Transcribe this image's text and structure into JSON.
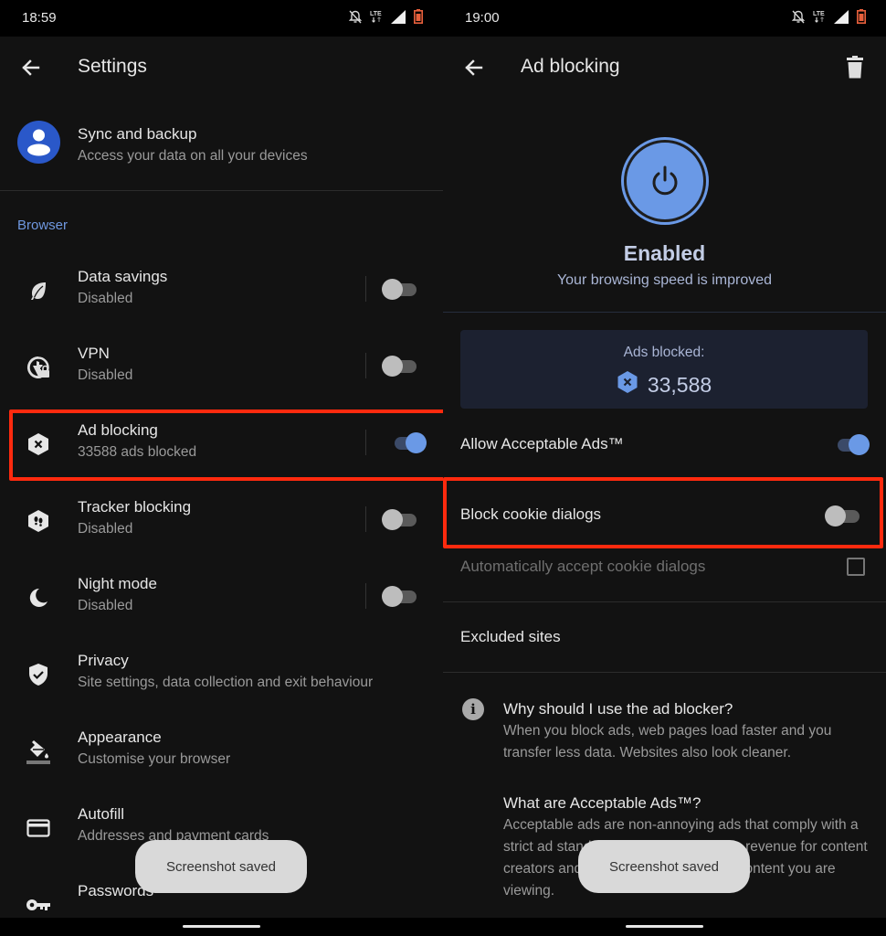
{
  "left": {
    "status": {
      "time": "18:59",
      "network": "LTE"
    },
    "appbar": {
      "title": "Settings"
    },
    "sync": {
      "title": "Sync and backup",
      "subtitle": "Access your data on all your devices"
    },
    "section_label": "Browser",
    "items": [
      {
        "id": "data-savings",
        "icon": "leaf-icon",
        "title": "Data savings",
        "subtitle": "Disabled",
        "toggle": false
      },
      {
        "id": "vpn",
        "icon": "globe-lock-icon",
        "title": "VPN",
        "subtitle": "Disabled",
        "toggle": false
      },
      {
        "id": "ad-blocking",
        "icon": "ad-block-hexagon-icon",
        "title": "Ad blocking",
        "subtitle": "33588 ads blocked",
        "toggle": true,
        "highlighted": true
      },
      {
        "id": "tracker-blocking",
        "icon": "footprints-hexagon-icon",
        "title": "Tracker blocking",
        "subtitle": "Disabled",
        "toggle": false
      },
      {
        "id": "night-mode",
        "icon": "moon-icon",
        "title": "Night mode",
        "subtitle": "Disabled",
        "toggle": false
      },
      {
        "id": "privacy",
        "icon": "shield-check-icon",
        "title": "Privacy",
        "subtitle": "Site settings, data collection and exit behaviour"
      },
      {
        "id": "appearance",
        "icon": "paint-bucket-icon",
        "title": "Appearance",
        "subtitle": "Customise your browser"
      },
      {
        "id": "autofill",
        "icon": "credit-card-icon",
        "title": "Autofill",
        "subtitle": "Addresses and payment cards"
      },
      {
        "id": "passwords",
        "icon": "key-icon",
        "title": "Passwords",
        "subtitle": ""
      }
    ],
    "toast": "Screenshot saved"
  },
  "right": {
    "status": {
      "time": "19:00",
      "network": "LTE"
    },
    "appbar": {
      "title": "Ad blocking"
    },
    "state": {
      "title": "Enabled",
      "subtitle": "Your browsing speed is improved"
    },
    "stats": {
      "label": "Ads blocked:",
      "value": "33,588"
    },
    "options": [
      {
        "id": "allow-acceptable-ads",
        "label": "Allow Acceptable Ads™",
        "toggle": true
      },
      {
        "id": "block-cookie-dialogs",
        "label": "Block cookie dialogs",
        "toggle": false,
        "highlighted": true
      },
      {
        "id": "auto-accept-cookie-dialogs",
        "label": "Automatically accept cookie dialogs",
        "checkbox": false,
        "disabled": true
      }
    ],
    "excluded_sites": "Excluded sites",
    "faq": [
      {
        "q": "Why should I use the ad blocker?",
        "a": "When you block ads, web pages load faster and you transfer less data. Websites also look cleaner."
      },
      {
        "q": "What are Acceptable Ads™?",
        "a": "Acceptable ads are non-annoying ads that comply with a strict ad standard. They help generate revenue for content creators and do not interfere with the content you are viewing."
      }
    ],
    "toast": "Screenshot saved"
  },
  "colors": {
    "accent": "#6a99e6",
    "highlight": "#ff2a0e",
    "background": "#121212",
    "stats_card": "#1c2130"
  }
}
